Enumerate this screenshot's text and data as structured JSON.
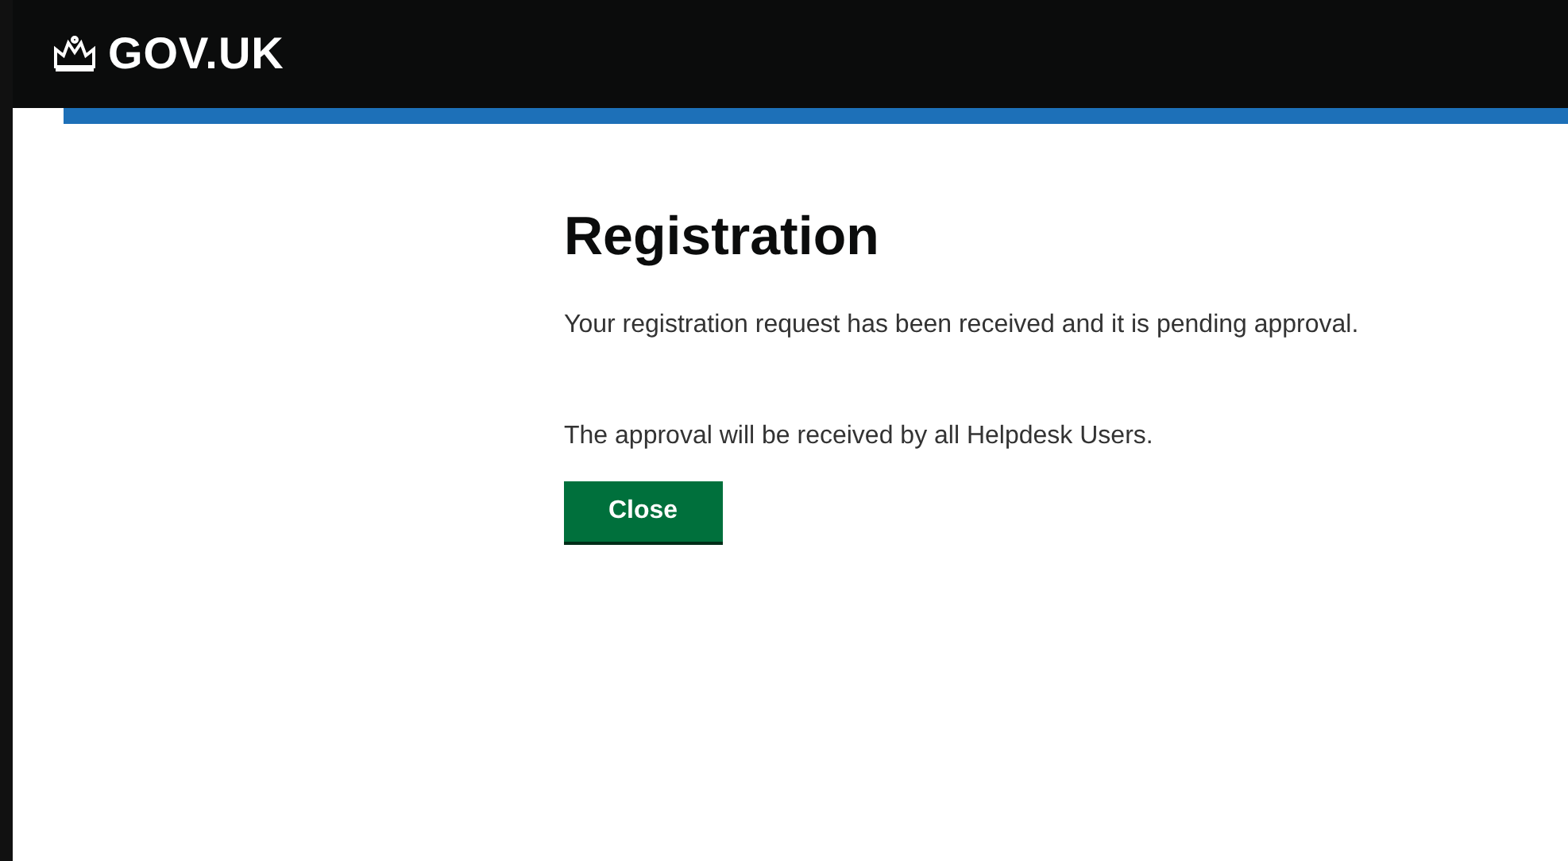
{
  "header": {
    "logo_text": "GOV.UK"
  },
  "main": {
    "title": "Registration",
    "paragraphs": [
      "Your registration request has been received and it is pending approval.",
      "The approval will be received by all Helpdesk Users."
    ],
    "button": "Close"
  }
}
